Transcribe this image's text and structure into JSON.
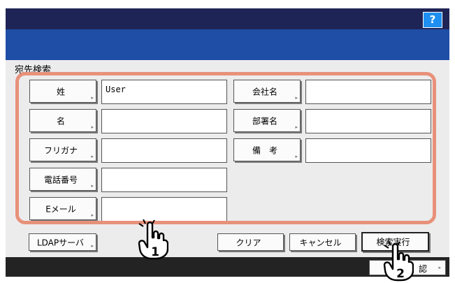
{
  "header": {
    "help_label": "?"
  },
  "panel": {
    "title": "宛先検索"
  },
  "left_fields": [
    {
      "label": "姓",
      "value": "User"
    },
    {
      "label": "名",
      "value": ""
    },
    {
      "label": "フリガナ",
      "value": ""
    },
    {
      "label": "電話番号",
      "value": ""
    },
    {
      "label": "Eメール",
      "value": ""
    }
  ],
  "right_fields": [
    {
      "label": "会社名",
      "value": ""
    },
    {
      "label": "部署名",
      "value": ""
    },
    {
      "label": "備　考",
      "value": ""
    }
  ],
  "actions": {
    "ldap": "LDAPサーバ",
    "clear": "クリア",
    "cancel": "キャンセル",
    "search": "検索実行"
  },
  "footer": {
    "confirm_label": "認"
  },
  "annotations": {
    "step1": "1",
    "step2": "2"
  },
  "icons": {
    "corner_arrow": "▸",
    "hand_pointer": "hand-pointer-icon"
  },
  "colors": {
    "highlight": "#e8917a",
    "title_bar": "#1f2456",
    "header_bar": "#1f4ea6",
    "help_button": "#1e8ff0"
  }
}
